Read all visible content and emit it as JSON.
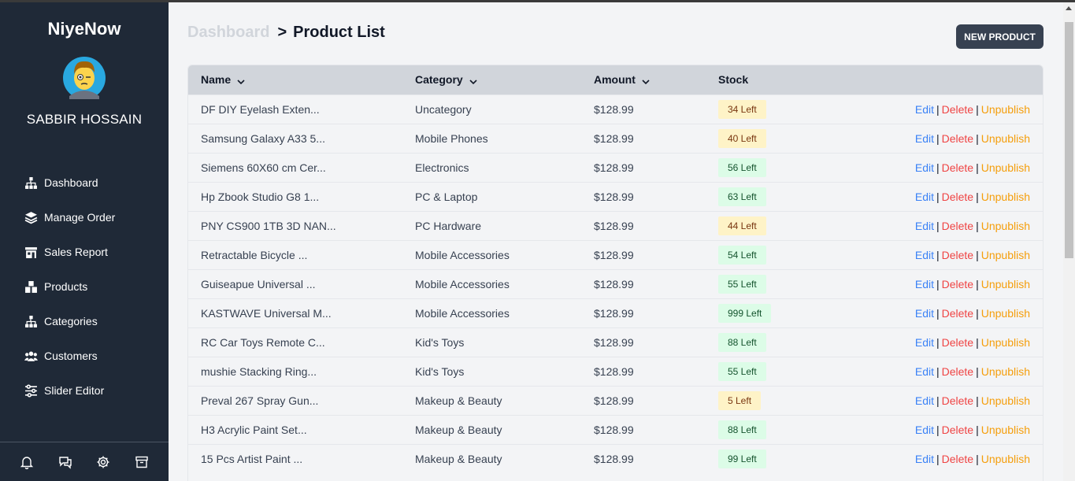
{
  "brand": "NiyeNow",
  "user": {
    "name": "SABBIR HOSSAIN"
  },
  "nav": [
    {
      "label": "Dashboard",
      "icon": "sitemap-icon"
    },
    {
      "label": "Manage Order",
      "icon": "layers-icon"
    },
    {
      "label": "Sales Report",
      "icon": "store-icon"
    },
    {
      "label": "Products",
      "icon": "cubes-icon"
    },
    {
      "label": "Categories",
      "icon": "sitemap-icon"
    },
    {
      "label": "Customers",
      "icon": "users-icon"
    },
    {
      "label": "Slider Editor",
      "icon": "sliders-icon"
    }
  ],
  "bottom_icons": [
    "bell-icon",
    "chat-icon",
    "gear-icon",
    "archive-icon"
  ],
  "breadcrumb": {
    "home": "Dashboard",
    "separator": ">",
    "current": "Product List"
  },
  "new_button": "NEW PRODUCT",
  "table": {
    "headers": {
      "name": "Name",
      "category": "Category",
      "amount": "Amount",
      "stock": "Stock"
    },
    "actions": {
      "edit": "Edit",
      "delete": "Delete",
      "unpublish": "Unpublish",
      "sep": "|"
    },
    "rows": [
      {
        "name": "DF DIY Eyelash Exten...",
        "category": "Uncategory",
        "amount": "$128.99",
        "stock": "34 Left",
        "level": "yellow"
      },
      {
        "name": "Samsung Galaxy A33 5...",
        "category": "Mobile Phones",
        "amount": "$128.99",
        "stock": "40 Left",
        "level": "yellow"
      },
      {
        "name": "Siemens 60X60 cm Cer...",
        "category": "Electronics",
        "amount": "$128.99",
        "stock": "56 Left",
        "level": "green"
      },
      {
        "name": "Hp Zbook Studio G8 1...",
        "category": "PC & Laptop",
        "amount": "$128.99",
        "stock": "63 Left",
        "level": "green"
      },
      {
        "name": "PNY CS900 1TB 3D NAN...",
        "category": "PC Hardware",
        "amount": "$128.99",
        "stock": "44 Left",
        "level": "yellow"
      },
      {
        "name": "Retractable Bicycle ...",
        "category": "Mobile Accessories",
        "amount": "$128.99",
        "stock": "54 Left",
        "level": "green"
      },
      {
        "name": "Guiseapue Universal ...",
        "category": "Mobile Accessories",
        "amount": "$128.99",
        "stock": "55 Left",
        "level": "green"
      },
      {
        "name": "KASTWAVE Universal M...",
        "category": "Mobile Accessories",
        "amount": "$128.99",
        "stock": "999 Left",
        "level": "green"
      },
      {
        "name": "RC Car Toys Remote C...",
        "category": "Kid's Toys",
        "amount": "$128.99",
        "stock": "88 Left",
        "level": "green"
      },
      {
        "name": "mushie Stacking Ring...",
        "category": "Kid's Toys",
        "amount": "$128.99",
        "stock": "55 Left",
        "level": "green"
      },
      {
        "name": "Preval 267 Spray Gun...",
        "category": "Makeup & Beauty",
        "amount": "$128.99",
        "stock": "5 Left",
        "level": "yellow"
      },
      {
        "name": "H3 Acrylic Paint Set...",
        "category": "Makeup & Beauty",
        "amount": "$128.99",
        "stock": "88 Left",
        "level": "green"
      },
      {
        "name": "15 Pcs Artist Paint ...",
        "category": "Makeup & Beauty",
        "amount": "$128.99",
        "stock": "99 Left",
        "level": "green"
      }
    ]
  }
}
